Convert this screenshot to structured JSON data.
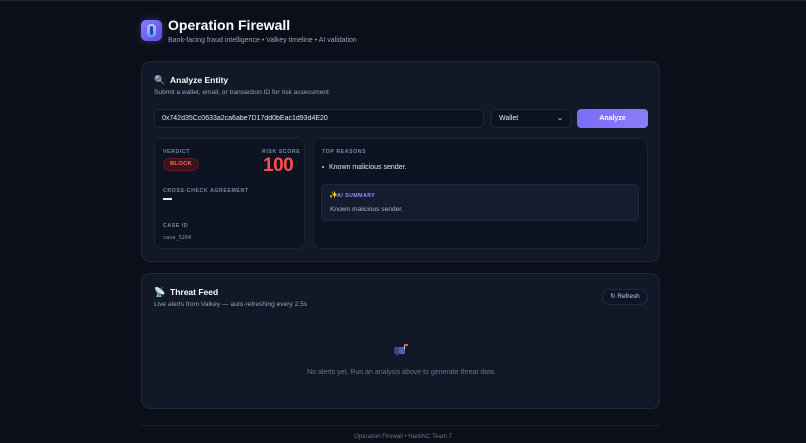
{
  "header": {
    "title": "Operation Firewall",
    "subtitle": "Bank-facing fraud intelligence • Valkey timeline • AI validation",
    "logo_icon": "shield-logo-icon"
  },
  "analyze": {
    "icon": "magnifier-icon",
    "title": "Analyze Entity",
    "subtitle": "Submit a wallet, email, or transaction ID for risk assessment",
    "input_value": "0x742d35Cc0633a2ca6abe7D17dd0bEac1d93d4E20",
    "type_selected": "Wallet",
    "analyze_label": "Analyze"
  },
  "result": {
    "verdict_label": "VERDICT",
    "verdict": "BLOCK",
    "risk_label": "RISK SCORE",
    "risk_score": "100",
    "agreement_label": "CROSS-CHECK AGREEMENT",
    "agreement_value": "—",
    "case_label": "CASE ID",
    "case_id": "case_5204",
    "reasons_label": "TOP REASONS",
    "reasons": [
      "Known malicious sender."
    ],
    "ai_summary_label": "AI SUMMARY",
    "ai_summary": "Known malicious sender."
  },
  "feed": {
    "icon": "satellite-dish-icon",
    "title": "Threat Feed",
    "subtitle": "Live alerts from Valkey — auto-refreshing every 2.5s",
    "refresh_label": "↻ Refresh",
    "empty_icon": "mailbox-icon",
    "empty_text": "No alerts yet. Run an analysis above to generate threat data."
  },
  "footer": "Operation Firewall • HackNC Team 7",
  "colors": {
    "background": "#0b0f1a",
    "card": "#111827",
    "accent": "#7b6cf6",
    "danger": "#ff4d4d"
  }
}
